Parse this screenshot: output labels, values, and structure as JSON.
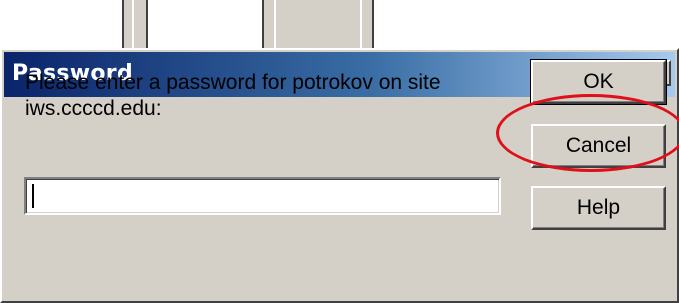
{
  "dialog": {
    "title": "Password",
    "close_label": "×",
    "prompt": "Please enter a password for potrokov on site iws.ccccd.edu:",
    "password_value": "",
    "buttons": {
      "ok": "OK",
      "cancel": "Cancel",
      "help": "Help"
    }
  },
  "annotation": {
    "highlighted_element": "ok-button",
    "color": "#e0101a"
  },
  "colors": {
    "title_gradient_start": "#0a246a",
    "title_gradient_end": "#a6caf0",
    "dialog_face": "#d4d0c8"
  }
}
